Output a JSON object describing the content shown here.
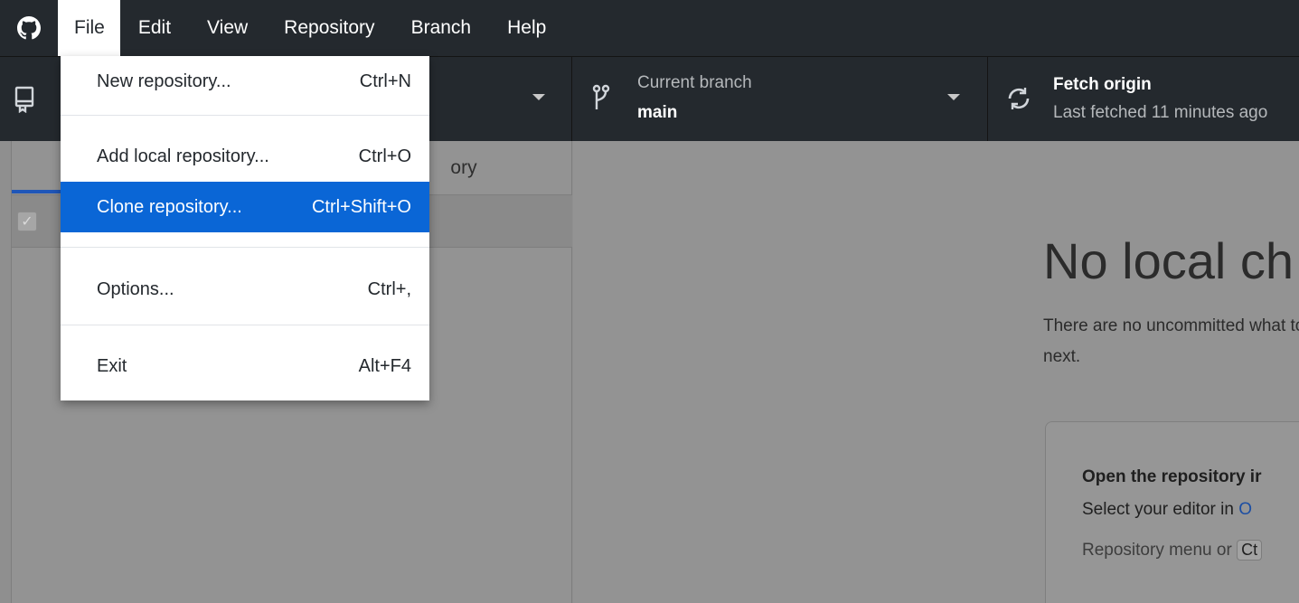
{
  "menubar": {
    "items": [
      {
        "label": "File",
        "active": true
      },
      {
        "label": "Edit"
      },
      {
        "label": "View"
      },
      {
        "label": "Repository"
      },
      {
        "label": "Branch"
      },
      {
        "label": "Help"
      }
    ]
  },
  "toolbar": {
    "branch": {
      "title": "Current branch",
      "value": "main"
    },
    "fetch": {
      "title": "Fetch origin",
      "subtitle": "Last fetched 11 minutes ago"
    }
  },
  "sidebar": {
    "tab_history_fragment": "ory"
  },
  "main": {
    "title": "No local ch",
    "description": "There are no uncommitted what to do next.",
    "card": {
      "title": "Open the repository ir",
      "line1_prefix": "Select your editor in ",
      "line1_link": "O",
      "line2_prefix": "Repository menu or ",
      "line2_kbd": "Ct"
    }
  },
  "file_menu": {
    "items": [
      {
        "label": "New repository...",
        "shortcut": "Ctrl+N"
      },
      {
        "label": "Add local repository...",
        "shortcut": "Ctrl+O"
      },
      {
        "label": "Clone repository...",
        "shortcut": "Ctrl+Shift+O",
        "highlighted": true
      },
      {
        "label": "Options...",
        "shortcut": "Ctrl+,"
      },
      {
        "label": "Exit",
        "shortcut": "Alt+F4"
      }
    ]
  },
  "colors": {
    "chrome": "#24292e",
    "highlight": "#0a66d6",
    "tab_underline": "#1f56b8"
  },
  "icons": [
    "github-logo-icon",
    "repository-icon",
    "branch-icon",
    "sync-icon",
    "chevron-down-icon",
    "checkbox-icon"
  ]
}
